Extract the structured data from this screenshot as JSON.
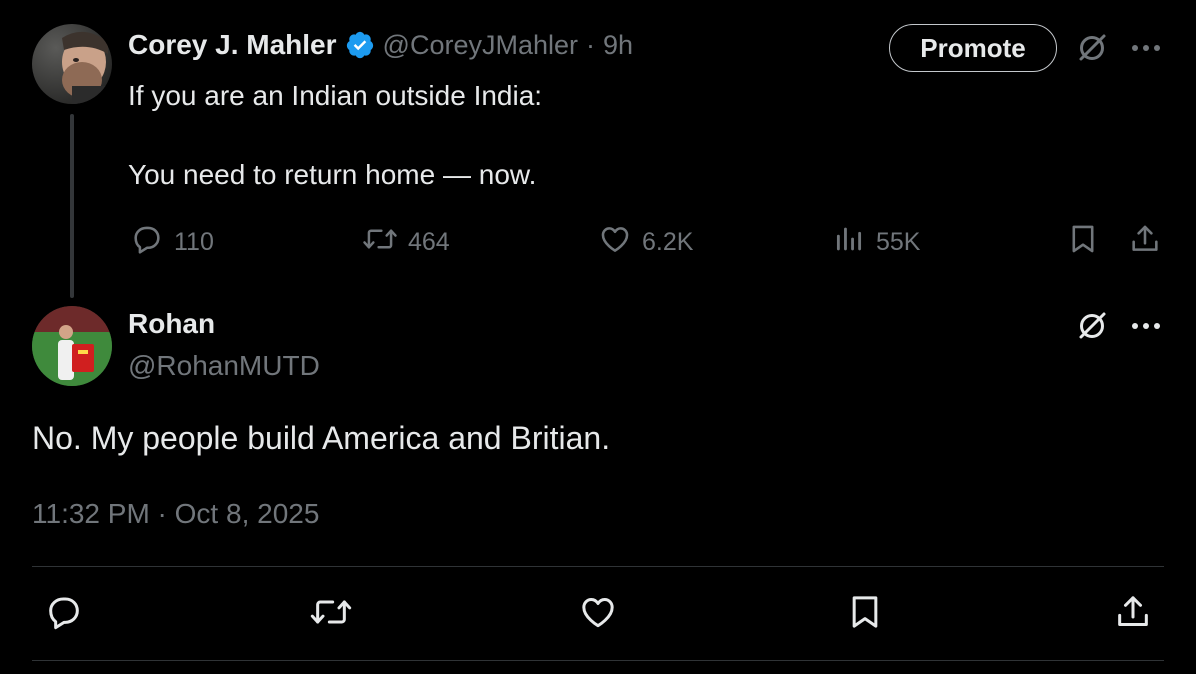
{
  "parent": {
    "author_name": "Corey J. Mahler",
    "handle": "@CoreyJMahler",
    "separator": "·",
    "time": "9h",
    "text_line1": "If you are an Indian outside India:",
    "text_line2": "You need to return home — now.",
    "promote_label": "Promote",
    "stats": {
      "replies": "110",
      "reposts": "464",
      "likes": "6.2K",
      "views": "55K"
    }
  },
  "reply": {
    "author_name": "Rohan",
    "handle": "@RohanMUTD",
    "text": "No. My people build America and Britian.",
    "timestamp": "11:32 PM · Oct 8, 2025"
  },
  "icons": {
    "verified": "verified-badge-icon",
    "grok": "grok-icon",
    "more": "more-icon",
    "reply": "reply-icon",
    "repost": "repost-icon",
    "like": "heart-icon",
    "views": "views-icon",
    "bookmark": "bookmark-icon",
    "share": "share-icon"
  },
  "colors": {
    "background": "#000000",
    "text_primary": "#e7e9ea",
    "text_secondary": "#71767b",
    "verified_blue": "#1d9bf0",
    "divider": "#2f3336"
  }
}
